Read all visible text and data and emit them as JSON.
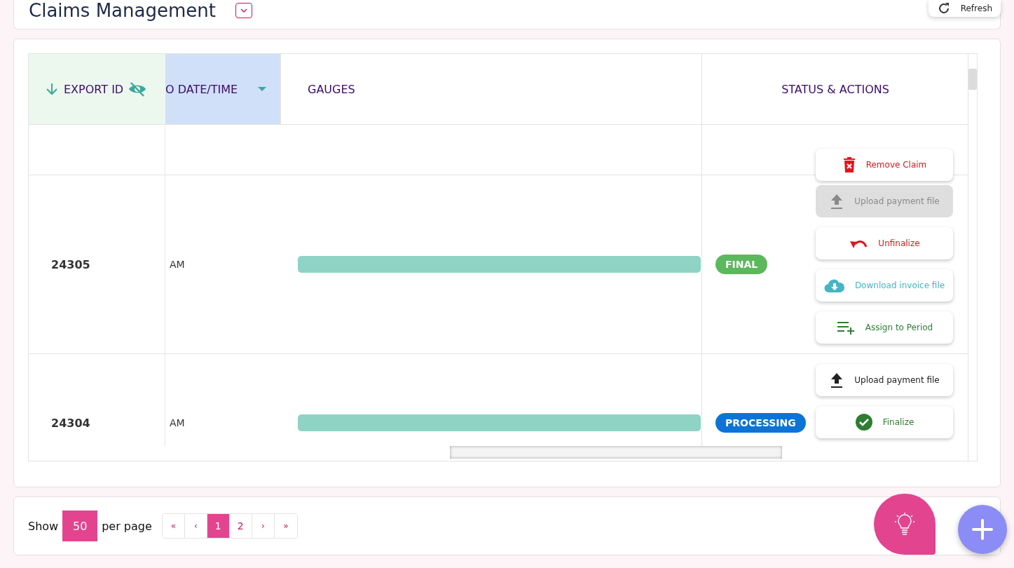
{
  "header": {
    "title": "Claims Management",
    "refresh_label": "Refresh"
  },
  "table": {
    "columns": [
      {
        "label": "EXPORT ID",
        "kind": "id"
      },
      {
        "label": "O DATE/TIME",
        "kind": "date"
      },
      {
        "label": "GAUGES",
        "kind": "gauge"
      },
      {
        "label": "STATUS & ACTIONS",
        "kind": "status"
      }
    ],
    "rows": [
      {
        "kind": "partial",
        "actions": [
          {
            "kind": "remove",
            "label": "Remove Claim",
            "disabled": false
          }
        ]
      },
      {
        "kind": "full",
        "export_id": "24305",
        "date": "AM",
        "gauge": {
          "level": 1
        },
        "status": {
          "label": "FINAL",
          "color": "#5cb85c"
        },
        "actions": [
          {
            "kind": "upload",
            "label": "Upload payment file",
            "disabled": true
          },
          {
            "kind": "unfinalize",
            "label": "Unfinalize",
            "disabled": false
          },
          {
            "kind": "download",
            "label": "Download invoice file",
            "disabled": false
          },
          {
            "kind": "assign",
            "label": "Assign to Period",
            "disabled": false
          }
        ]
      },
      {
        "kind": "full",
        "export_id": "24304",
        "date": "AM",
        "gauge": {
          "level": 1
        },
        "status": {
          "label": "PROCESSING",
          "color": "#0b74d6"
        },
        "actions": [
          {
            "kind": "upload",
            "label": "Upload payment file",
            "disabled": false
          },
          {
            "kind": "finalize",
            "label": "Finalize",
            "disabled": false
          }
        ]
      }
    ]
  },
  "pagination": {
    "show_label": "Show",
    "page_size": "50",
    "per_page_label": "per page",
    "pages": [
      {
        "label": "«",
        "kind": "first",
        "selected": false
      },
      {
        "label": "‹",
        "kind": "prev",
        "selected": false
      },
      {
        "label": "1",
        "kind": "page",
        "selected": true
      },
      {
        "label": "2",
        "kind": "page",
        "selected": false
      },
      {
        "label": "›",
        "kind": "next",
        "selected": false
      },
      {
        "label": "»",
        "kind": "last",
        "selected": false
      }
    ]
  }
}
